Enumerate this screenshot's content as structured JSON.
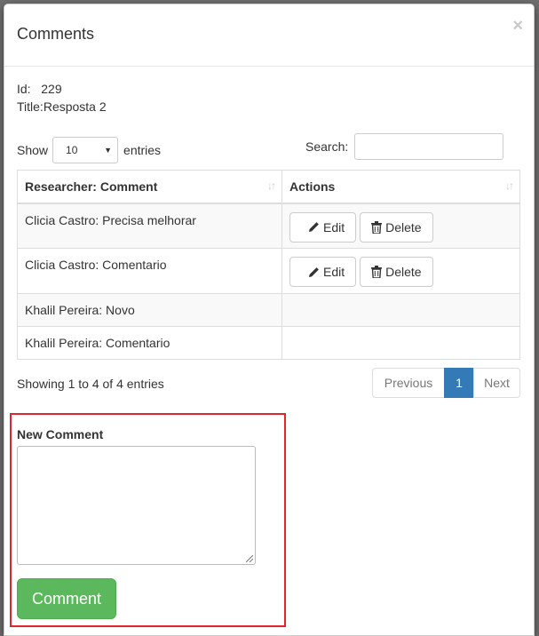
{
  "background": {
    "title_fragment": "..."
  },
  "modal": {
    "title": "Comments",
    "close_symbol": "×",
    "info": {
      "id_label": "Id:",
      "id_value": "229",
      "title_label": "Title:",
      "title_value": "Resposta 2"
    }
  },
  "table_controls": {
    "show_label": "Show",
    "page_length": "10",
    "entries_label": "entries",
    "search_label": "Search:",
    "search_value": ""
  },
  "table": {
    "columns": [
      "Researcher: Comment",
      "Actions"
    ],
    "rows": [
      {
        "comment": "Clicia Castro: Precisa melhorar",
        "actions": true
      },
      {
        "comment": "Clicia Castro: Comentario",
        "actions": true
      },
      {
        "comment": "Khalil Pereira: Novo",
        "actions": false
      },
      {
        "comment": "Khalil Pereira: Comentario",
        "actions": false
      }
    ],
    "edit_label": "Edit",
    "delete_label": "Delete"
  },
  "footer": {
    "info": "Showing 1 to 4 of 4 entries",
    "previous": "Previous",
    "current_page": "1",
    "next": "Next"
  },
  "new_comment": {
    "label": "New Comment",
    "value": "",
    "button": "Comment"
  },
  "colors": {
    "primary": "#337ab7",
    "success": "#5cb85c",
    "highlight_border": "#e3242b"
  },
  "icons": [
    "pencil-icon",
    "trash-icon",
    "sort-icon",
    "close-icon",
    "caret-down-icon",
    "resize-grip-icon"
  ]
}
